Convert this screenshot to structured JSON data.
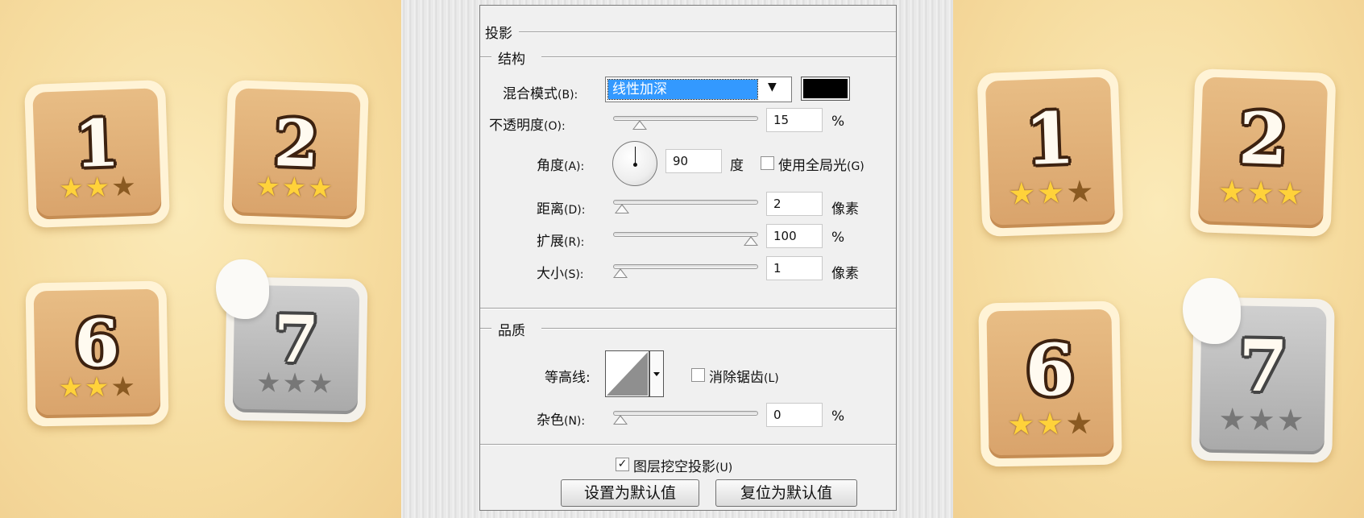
{
  "sections": {
    "shadow_title": "投影",
    "structure_title": "结构",
    "quality_title": "品质"
  },
  "blend_mode": {
    "label": "混合模式",
    "shortcut": "(B):",
    "value": "线性加深",
    "color_hex": "#000000"
  },
  "opacity": {
    "label": "不透明度",
    "shortcut": "(O):",
    "value": "15",
    "unit": "%",
    "fraction": 0.15
  },
  "angle": {
    "label": "角度",
    "shortcut": "(A):",
    "value": "90",
    "unit": "度",
    "global_light_label": "使用全局光",
    "global_light_shortcut": "(G)",
    "global_light_checked": false
  },
  "distance": {
    "label": "距离",
    "shortcut": "(D):",
    "value": "2",
    "unit": "像素",
    "fraction": 0.01
  },
  "spread": {
    "label": "扩展",
    "shortcut": "(R):",
    "value": "100",
    "unit": "%",
    "fraction": 1.0
  },
  "size": {
    "label": "大小",
    "shortcut": "(S):",
    "value": "1",
    "unit": "像素",
    "fraction": 0.0
  },
  "contour": {
    "label": "等高线:",
    "anti_alias_label": "消除锯齿",
    "anti_alias_shortcut": "(L)",
    "anti_alias_checked": false
  },
  "noise": {
    "label": "杂色",
    "shortcut": "(N):",
    "value": "0",
    "unit": "%",
    "fraction": 0.0
  },
  "knockout": {
    "label": "图层挖空投影",
    "shortcut": "(U)",
    "checked": true,
    "check_mark": "✓"
  },
  "buttons": {
    "make_default": "设置为默认值",
    "reset_default": "复位为默认值"
  },
  "preview_tiles": [
    {
      "number": "1",
      "stars": [
        "gold",
        "gold",
        "brown"
      ],
      "locked": false
    },
    {
      "number": "2",
      "stars": [
        "gold",
        "gold",
        "gold"
      ],
      "locked": false
    },
    {
      "number": "6",
      "stars": [
        "gold",
        "gold",
        "brown"
      ],
      "locked": false
    },
    {
      "number": "7",
      "stars": [
        "grey",
        "grey",
        "grey"
      ],
      "locked": true
    }
  ],
  "star_glyph": "★",
  "colors": {
    "dialog_bg": "#f0f0f0",
    "selection_blue": "#3399ff",
    "tile_brown": "#d9a36b",
    "tile_locked": "#a9a9a9"
  }
}
